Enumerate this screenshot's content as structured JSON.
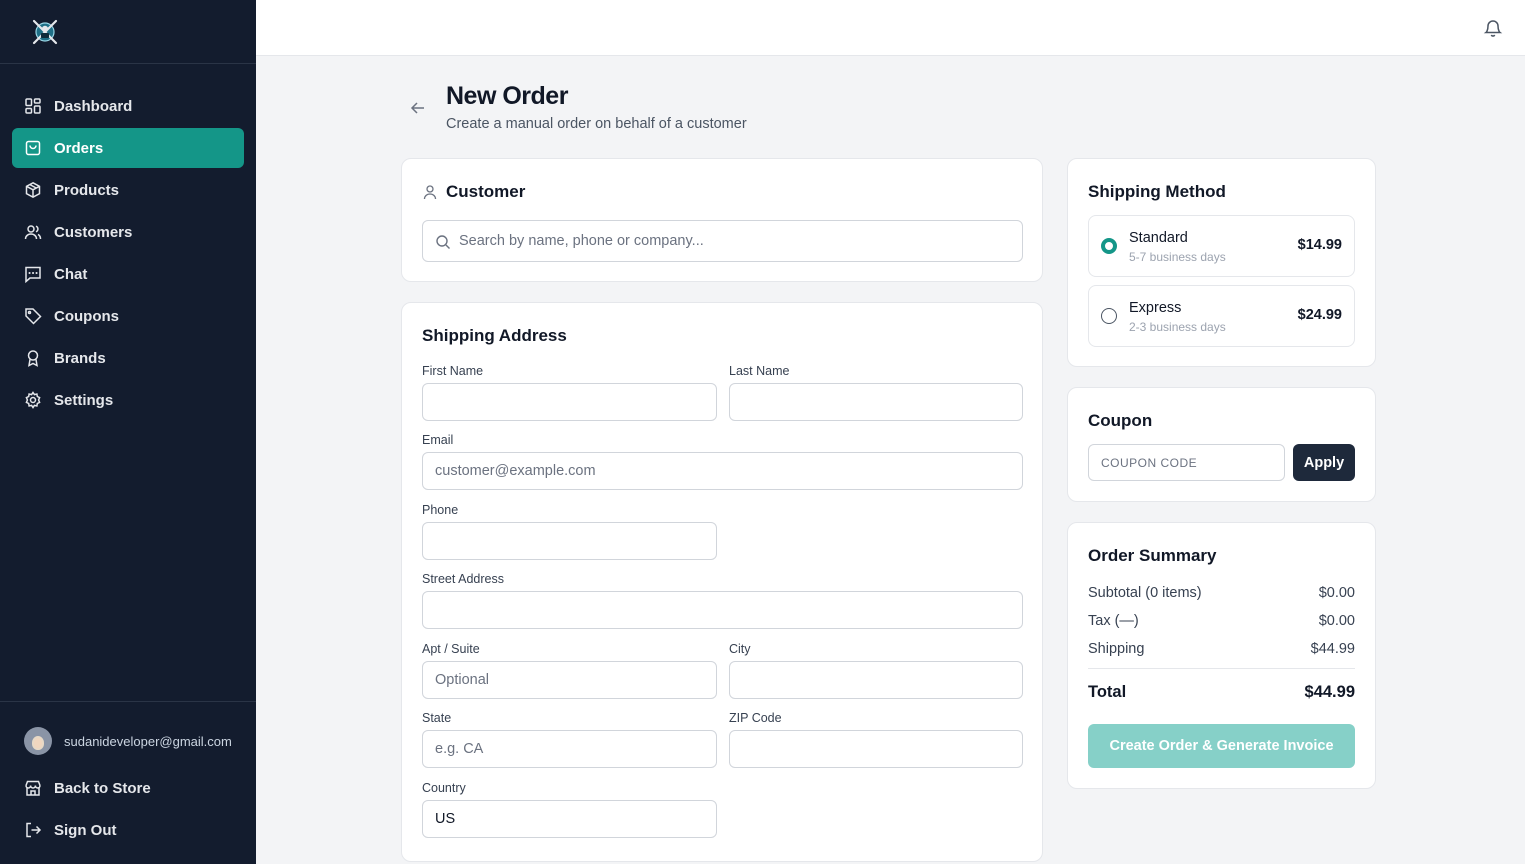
{
  "sidebar": {
    "logo": "store-logo",
    "nav": [
      {
        "label": "Dashboard",
        "icon": "grid-icon",
        "active": false
      },
      {
        "label": "Orders",
        "icon": "shopping-bag-icon",
        "active": true
      },
      {
        "label": "Products",
        "icon": "box-icon",
        "active": false
      },
      {
        "label": "Customers",
        "icon": "users-icon",
        "active": false
      },
      {
        "label": "Chat",
        "icon": "message-icon",
        "active": false
      },
      {
        "label": "Coupons",
        "icon": "tag-icon",
        "active": false
      },
      {
        "label": "Brands",
        "icon": "award-icon",
        "active": false
      },
      {
        "label": "Settings",
        "icon": "gear-icon",
        "active": false
      }
    ],
    "user_email": "sudanideveloper@gmail.com",
    "back_to_store": "Back to Store",
    "sign_out": "Sign Out"
  },
  "header": {
    "title": "New Order",
    "subtitle": "Create a manual order on behalf of a customer"
  },
  "customer": {
    "title": "Customer",
    "search_placeholder": "Search by name, phone or company..."
  },
  "shipping_address": {
    "title": "Shipping Address",
    "first_name_label": "First Name",
    "last_name_label": "Last Name",
    "email_label": "Email",
    "email_placeholder": "customer@example.com",
    "phone_label": "Phone",
    "street_label": "Street Address",
    "apt_label": "Apt / Suite",
    "apt_placeholder": "Optional",
    "city_label": "City",
    "state_label": "State",
    "state_placeholder": "e.g. CA",
    "zip_label": "ZIP Code",
    "country_label": "Country",
    "country_value": "US"
  },
  "shipping_method": {
    "title": "Shipping Method",
    "options": [
      {
        "name": "Standard",
        "sub": "5-7 business days",
        "price": "$14.99",
        "selected": true
      },
      {
        "name": "Express",
        "sub": "2-3 business days",
        "price": "$24.99",
        "selected": false
      }
    ]
  },
  "coupon": {
    "title": "Coupon",
    "placeholder": "COUPON CODE",
    "apply": "Apply"
  },
  "summary": {
    "title": "Order Summary",
    "subtotal_label": "Subtotal (0 items)",
    "subtotal_value": "$0.00",
    "tax_label": "Tax (—)",
    "tax_value": "$0.00",
    "shipping_label": "Shipping",
    "shipping_value": "$44.99",
    "total_label": "Total",
    "total_value": "$44.99",
    "create_button": "Create Order & Generate Invoice"
  },
  "colors": {
    "sidebar_bg": "#131c2e",
    "accent": "#149688",
    "accent_disabled": "#86d0c8",
    "dark_button": "#1e293b"
  }
}
